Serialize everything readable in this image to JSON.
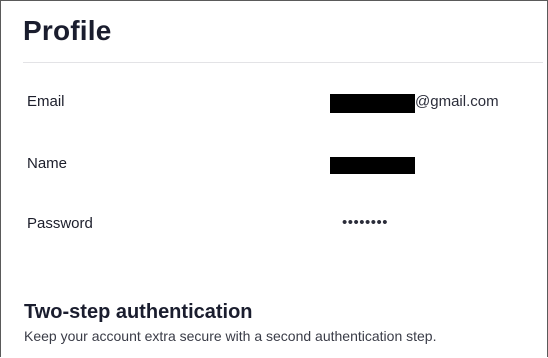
{
  "profile": {
    "title": "Profile",
    "fields": {
      "email": {
        "label": "Email",
        "value_suffix": "@gmail.com"
      },
      "name": {
        "label": "Name"
      },
      "password": {
        "label": "Password",
        "value": "••••••••"
      }
    }
  },
  "two_step": {
    "title": "Two-step authentication",
    "description": "Keep your account extra secure with a second authentication step."
  }
}
